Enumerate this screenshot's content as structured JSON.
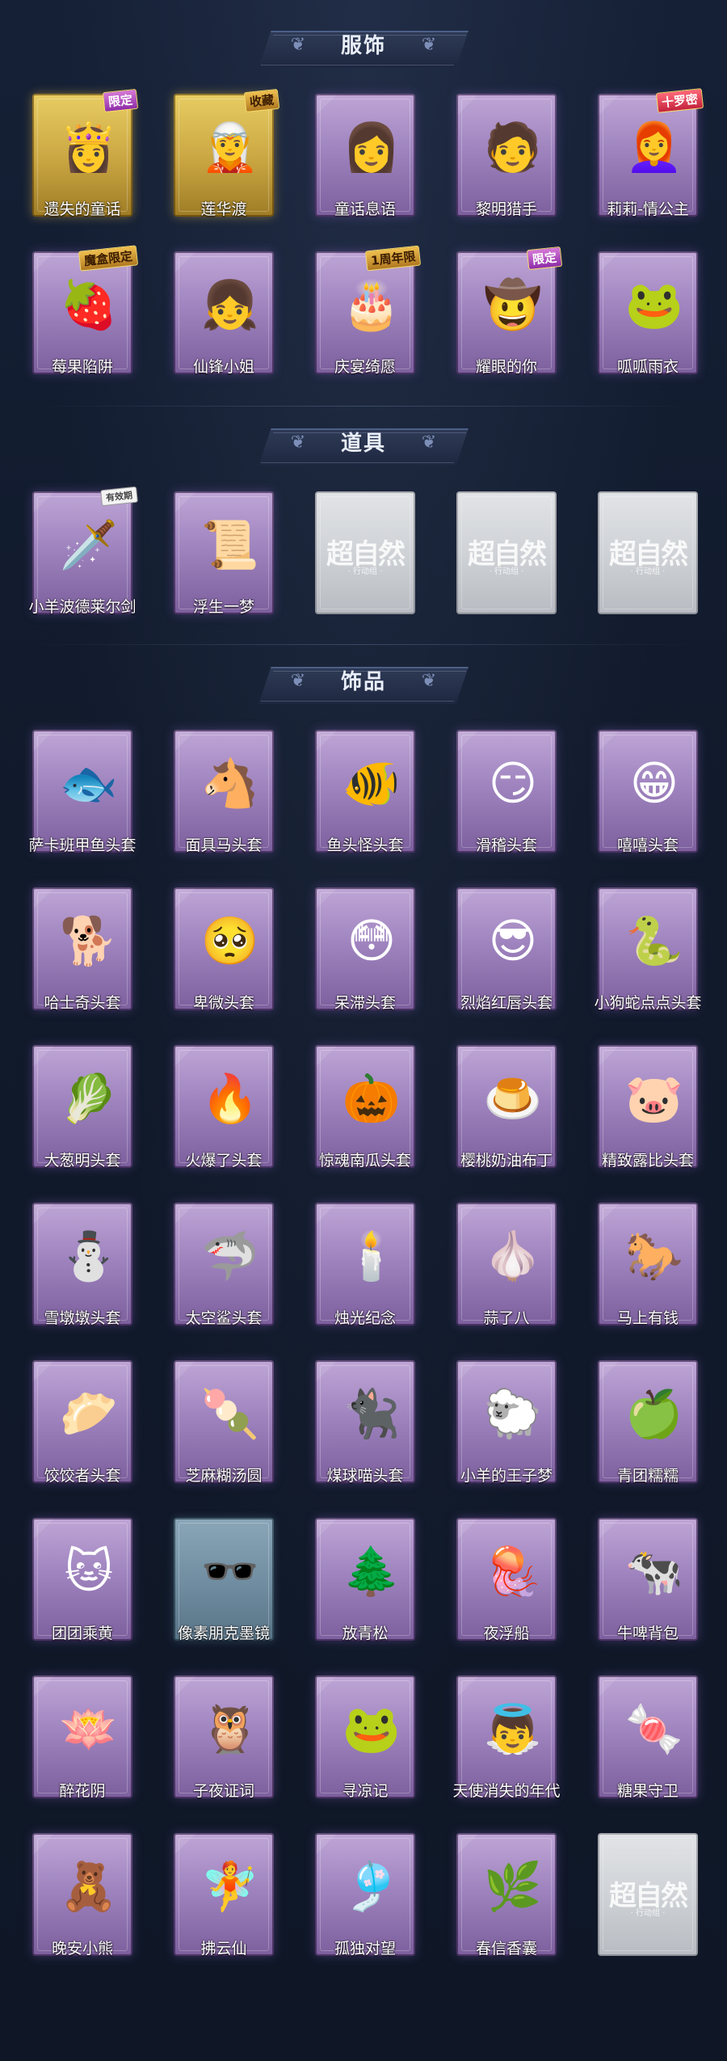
{
  "sections": [
    {
      "title": "服饰",
      "items": [
        {
          "label": "遗失的童话",
          "tag": "限定",
          "frame": "gold",
          "icon": "👸",
          "name": "lost-fairytale"
        },
        {
          "label": "莲华渡",
          "tag": "收藏",
          "frame": "gold",
          "icon": "🧝",
          "name": "lotus-crossing"
        },
        {
          "label": "童话息语",
          "tag": "",
          "frame": "purple",
          "icon": "👩",
          "name": "fairytale-whisper"
        },
        {
          "label": "黎明猎手",
          "tag": "",
          "frame": "purple",
          "icon": "🧑",
          "name": "dawn-hunter"
        },
        {
          "label": "莉莉-情公主",
          "tag": "十罗密",
          "frame": "purple",
          "icon": "👩‍🦰",
          "name": "lily-princess"
        },
        {
          "label": "莓果陷阱",
          "tag": "魔盒限定",
          "frame": "purple",
          "icon": "🍓",
          "name": "berry-trap"
        },
        {
          "label": "仙锋小姐",
          "tag": "",
          "frame": "purple",
          "icon": "👧",
          "name": "fairy-lady"
        },
        {
          "label": "庆宴绮愿",
          "tag": "1周年限",
          "frame": "purple",
          "icon": "🎂",
          "name": "banquet-wish"
        },
        {
          "label": "耀眼的你",
          "tag": "限定",
          "frame": "purple",
          "icon": "🤠",
          "name": "dazzling-you"
        },
        {
          "label": "呱呱雨衣",
          "tag": "",
          "frame": "purple",
          "icon": "🐸",
          "name": "frog-raincoat"
        }
      ]
    },
    {
      "title": "道具",
      "items": [
        {
          "label": "小羊波德莱尔剑",
          "tag": "有效期",
          "frame": "purple",
          "icon": "🗡️",
          "name": "lamb-sword"
        },
        {
          "label": "浮生一梦",
          "tag": "",
          "frame": "purple",
          "icon": "📜",
          "name": "floating-dream"
        },
        {
          "label": "",
          "tag": "",
          "frame": "silver",
          "icon": "",
          "name": "placeholder-1"
        },
        {
          "label": "",
          "tag": "",
          "frame": "silver",
          "icon": "",
          "name": "placeholder-2"
        },
        {
          "label": "",
          "tag": "",
          "frame": "silver",
          "icon": "",
          "name": "placeholder-3"
        }
      ]
    },
    {
      "title": "饰品",
      "items": [
        {
          "label": "萨卡班甲鱼头套",
          "tag": "",
          "frame": "purple",
          "icon": "🐟",
          "name": "fish-headgear"
        },
        {
          "label": "面具马头套",
          "tag": "",
          "frame": "purple",
          "icon": "🐴",
          "name": "horse-mask"
        },
        {
          "label": "鱼头怪头套",
          "tag": "",
          "frame": "purple",
          "icon": "🐠",
          "name": "fishhead-monster"
        },
        {
          "label": "滑稽头套",
          "tag": "",
          "frame": "purple",
          "icon": "😏",
          "name": "funny-head"
        },
        {
          "label": "嘻嘻头套",
          "tag": "",
          "frame": "purple",
          "icon": "😁",
          "name": "giggle-head"
        },
        {
          "label": "哈士奇头套",
          "tag": "",
          "frame": "purple",
          "icon": "🐕",
          "name": "husky-head"
        },
        {
          "label": "卑微头套",
          "tag": "",
          "frame": "purple",
          "icon": "🥺",
          "name": "humble-head"
        },
        {
          "label": "呆滞头套",
          "tag": "",
          "frame": "purple",
          "icon": "😳",
          "name": "dazed-head"
        },
        {
          "label": "烈焰红唇头套",
          "tag": "",
          "frame": "purple",
          "icon": "😎",
          "name": "red-lips-head"
        },
        {
          "label": "小狗蛇点点头套",
          "tag": "",
          "frame": "purple",
          "icon": "🐍",
          "name": "dotted-snake-head"
        },
        {
          "label": "大葱明头套",
          "tag": "",
          "frame": "purple",
          "icon": "🥬",
          "name": "scallion-head"
        },
        {
          "label": "火爆了头套",
          "tag": "",
          "frame": "purple",
          "icon": "🔥",
          "name": "fire-head"
        },
        {
          "label": "惊魂南瓜头套",
          "tag": "",
          "frame": "purple",
          "icon": "🎃",
          "name": "pumpkin-head"
        },
        {
          "label": "樱桃奶油布丁",
          "tag": "",
          "frame": "purple",
          "icon": "🍮",
          "name": "cherry-pudding"
        },
        {
          "label": "精致露比头套",
          "tag": "",
          "frame": "purple",
          "icon": "🐷",
          "name": "ruby-head"
        },
        {
          "label": "雪墩墩头套",
          "tag": "",
          "frame": "purple",
          "icon": "⛄",
          "name": "snowman-head"
        },
        {
          "label": "太空鲨头套",
          "tag": "",
          "frame": "purple",
          "icon": "🦈",
          "name": "space-shark-head"
        },
        {
          "label": "烛光纪念",
          "tag": "",
          "frame": "purple",
          "icon": "🕯️",
          "name": "candle-memory"
        },
        {
          "label": "蒜了八",
          "tag": "",
          "frame": "purple",
          "icon": "🧄",
          "name": "garlic-head"
        },
        {
          "label": "马上有钱",
          "tag": "",
          "frame": "purple",
          "icon": "🐎",
          "name": "horse-money"
        },
        {
          "label": "饺饺者头套",
          "tag": "",
          "frame": "purple",
          "icon": "🥟",
          "name": "dumpling-head"
        },
        {
          "label": "芝麻糊汤圆",
          "tag": "",
          "frame": "purple",
          "icon": "🍡",
          "name": "sesame-tangyuan"
        },
        {
          "label": "煤球喵头套",
          "tag": "",
          "frame": "purple",
          "icon": "🐈‍⬛",
          "name": "black-cat-head"
        },
        {
          "label": "小羊的王子梦",
          "tag": "",
          "frame": "purple",
          "icon": "🐑",
          "name": "lamb-prince"
        },
        {
          "label": "青团糯糯",
          "tag": "",
          "frame": "purple",
          "icon": "🍏",
          "name": "green-dumpling"
        },
        {
          "label": "团团乘黄",
          "tag": "",
          "frame": "purple",
          "icon": "🐱",
          "name": "tuantuan"
        },
        {
          "label": "像素朋克墨镜",
          "tag": "",
          "frame": "steel",
          "icon": "🕶️",
          "name": "pixel-sunglasses"
        },
        {
          "label": "放青松",
          "tag": "",
          "frame": "purple",
          "icon": "🌲",
          "name": "green-pine"
        },
        {
          "label": "夜浮船",
          "tag": "",
          "frame": "purple",
          "icon": "🪼",
          "name": "night-boat"
        },
        {
          "label": "牛啤背包",
          "tag": "",
          "frame": "purple",
          "icon": "🐄",
          "name": "cow-backpack"
        },
        {
          "label": "醉花阴",
          "tag": "",
          "frame": "purple",
          "icon": "🪷",
          "name": "drunk-flower"
        },
        {
          "label": "子夜证词",
          "tag": "",
          "frame": "purple",
          "icon": "🦉",
          "name": "midnight-testimony"
        },
        {
          "label": "寻凉记",
          "tag": "",
          "frame": "purple",
          "icon": "🐸",
          "name": "seeking-cool"
        },
        {
          "label": "天使消失的年代",
          "tag": "",
          "frame": "purple",
          "icon": "👼",
          "name": "angel-era"
        },
        {
          "label": "糖果守卫",
          "tag": "",
          "frame": "purple",
          "icon": "🍬",
          "name": "candy-guard"
        },
        {
          "label": "晚安小熊",
          "tag": "",
          "frame": "purple",
          "icon": "🧸",
          "name": "goodnight-bear"
        },
        {
          "label": "拂云仙",
          "tag": "",
          "frame": "purple",
          "icon": "🧚",
          "name": "cloud-fairy"
        },
        {
          "label": "孤独对望",
          "tag": "",
          "frame": "purple",
          "icon": "🎐",
          "name": "lonely-gaze"
        },
        {
          "label": "春信香囊",
          "tag": "",
          "frame": "purple",
          "icon": "🌿",
          "name": "spring-sachet"
        },
        {
          "label": "",
          "tag": "",
          "frame": "silver",
          "icon": "",
          "name": "placeholder-4"
        }
      ]
    }
  ],
  "watermark": {
    "main": "超自然",
    "sub": "· 行动组 ·"
  },
  "deco_icons": {
    "left": "❦",
    "right": "❦"
  }
}
